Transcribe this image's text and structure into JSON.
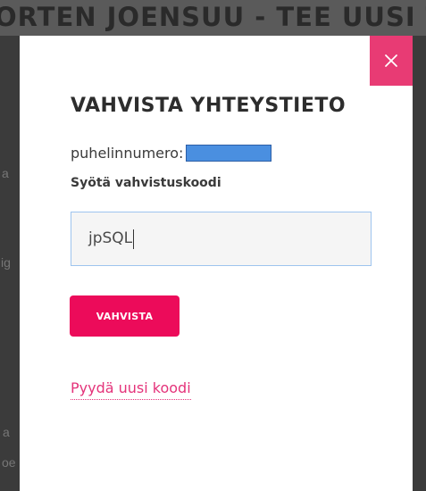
{
  "background": {
    "header_text": "ORTEN JOENSUU - TEE UUSI TI",
    "fragments": [
      "a",
      "ig",
      "a",
      "oe"
    ]
  },
  "modal": {
    "close_icon": "close-icon",
    "title": "VAHVISTA YHTEYSTIETO",
    "phone_label": "puhelinnumero:",
    "code_label": "Syötä vahvistuskoodi",
    "code_value": "jpSQL",
    "submit_label": "VAHVISTA",
    "resend_label": "Pyydä uusi koodi"
  },
  "colors": {
    "accent": "#ec0b5a",
    "close_bg": "#e83b74",
    "link": "#e4337a",
    "redaction": "#4a8fe0"
  }
}
